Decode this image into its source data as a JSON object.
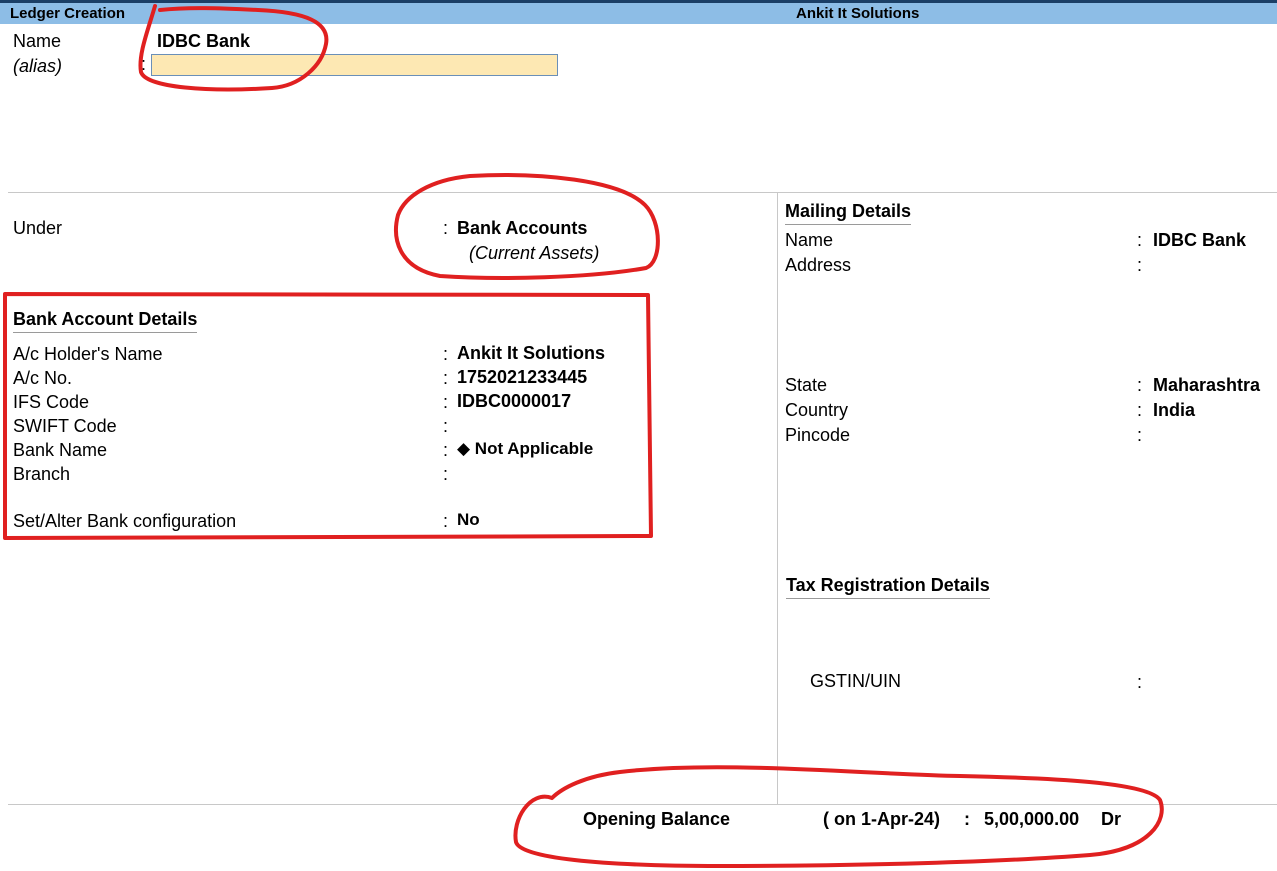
{
  "header": {
    "screen_title": "Ledger Creation",
    "company": "Ankit It Solutions"
  },
  "ledger": {
    "name_label": "Name",
    "name_value": "IDBC Bank",
    "alias_label": "(alias)",
    "alias_colon": ":",
    "alias_value": ""
  },
  "under": {
    "label": "Under",
    "colon": ":",
    "value": "Bank Accounts",
    "subvalue": "(Current Assets)"
  },
  "bank_details": {
    "title": "Bank Account Details",
    "rows": [
      {
        "label": "A/c Holder's Name",
        "colon": ":",
        "value": "Ankit It Solutions"
      },
      {
        "label": "A/c No.",
        "colon": ":",
        "value": "1752021233445"
      },
      {
        "label": "IFS Code",
        "colon": ":",
        "value": "IDBC0000017"
      },
      {
        "label": "SWIFT Code",
        "colon": ":",
        "value": ""
      },
      {
        "label": "Bank Name",
        "colon": ":",
        "value": "◆ Not Applicable"
      },
      {
        "label": "Branch",
        "colon": ":",
        "value": ""
      }
    ],
    "config": {
      "label": "Set/Alter Bank configuration",
      "colon": ":",
      "value": "No"
    }
  },
  "mailing": {
    "title": "Mailing Details",
    "rows": [
      {
        "label": "Name",
        "colon": ":",
        "value": "IDBC Bank"
      },
      {
        "label": "Address",
        "colon": ":",
        "value": ""
      },
      {
        "label": "State",
        "colon": ":",
        "value": "Maharashtra"
      },
      {
        "label": "Country",
        "colon": ":",
        "value": "India"
      },
      {
        "label": "Pincode",
        "colon": ":",
        "value": ""
      }
    ]
  },
  "tax": {
    "title": "Tax Registration Details",
    "gstin_label": "GSTIN/UIN",
    "gstin_colon": ":",
    "gstin_value": ""
  },
  "opening_balance": {
    "label": "Opening Balance",
    "date": "( on 1-Apr-24)",
    "colon": ":",
    "amount": "5,00,000.00",
    "type": "Dr"
  },
  "annotation_color": "#e02020"
}
